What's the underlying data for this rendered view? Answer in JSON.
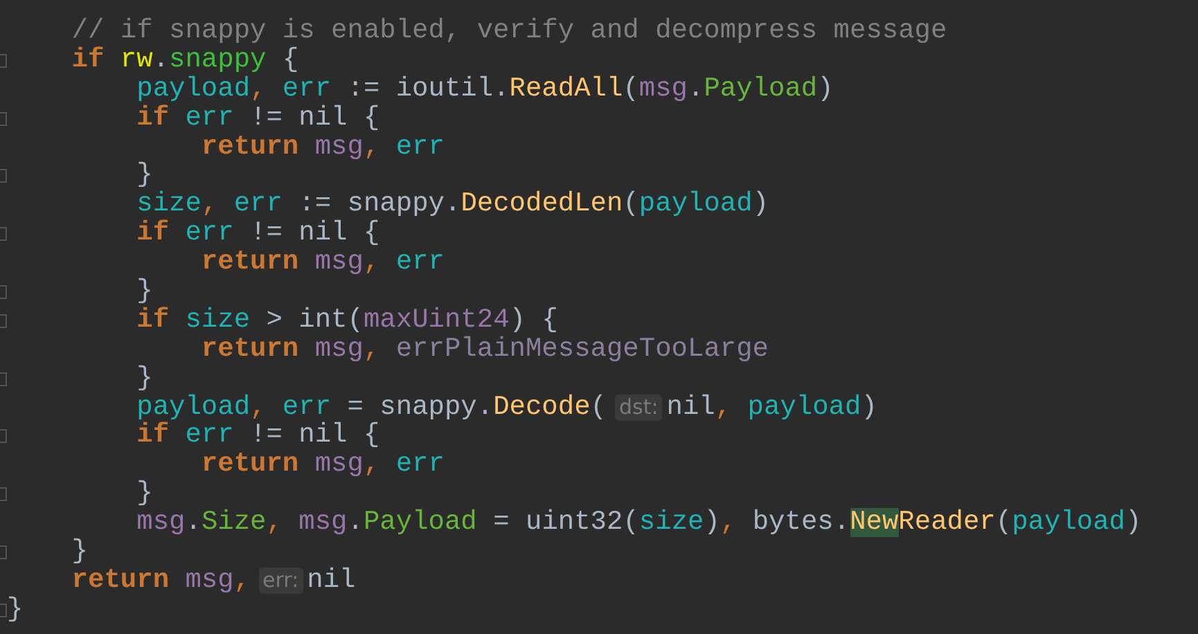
{
  "editor": {
    "lines": [
      {
        "fold": false,
        "tokens": [
          {
            "kind": "comment",
            "text": "    // if snappy is enabled, verify and decompress message"
          }
        ]
      },
      {
        "fold": true,
        "tokens": [
          {
            "kind": "keyword",
            "text": "    if"
          },
          {
            "kind": "receiver",
            "text": " rw"
          },
          {
            "kind": "plain",
            "text": "."
          },
          {
            "kind": "member",
            "text": "snappy"
          },
          {
            "kind": "plain",
            "text": " {"
          }
        ]
      },
      {
        "fold": false,
        "tokens": [
          {
            "kind": "variable",
            "text": "        payload"
          },
          {
            "kind": "punct",
            "text": ","
          },
          {
            "kind": "variable",
            "text": " err"
          },
          {
            "kind": "plain",
            "text": " := ioutil."
          },
          {
            "kind": "function",
            "text": "ReadAll"
          },
          {
            "kind": "plain",
            "text": "("
          },
          {
            "kind": "object",
            "text": "msg"
          },
          {
            "kind": "plain",
            "text": "."
          },
          {
            "kind": "field",
            "text": "Payload"
          },
          {
            "kind": "plain",
            "text": ")"
          }
        ]
      },
      {
        "fold": true,
        "tokens": [
          {
            "kind": "keyword",
            "text": "        if"
          },
          {
            "kind": "variable",
            "text": " err"
          },
          {
            "kind": "plain",
            "text": " != nil {"
          }
        ]
      },
      {
        "fold": false,
        "tokens": [
          {
            "kind": "keyword",
            "text": "            return"
          },
          {
            "kind": "object",
            "text": " msg"
          },
          {
            "kind": "punct",
            "text": ","
          },
          {
            "kind": "variable",
            "text": " err"
          }
        ]
      },
      {
        "fold": true,
        "tokens": [
          {
            "kind": "plain",
            "text": "        }"
          }
        ]
      },
      {
        "fold": false,
        "tokens": [
          {
            "kind": "variable",
            "text": "        size"
          },
          {
            "kind": "punct",
            "text": ","
          },
          {
            "kind": "variable",
            "text": " err"
          },
          {
            "kind": "plain",
            "text": " := snappy."
          },
          {
            "kind": "function",
            "text": "DecodedLen"
          },
          {
            "kind": "plain",
            "text": "("
          },
          {
            "kind": "variable",
            "text": "payload"
          },
          {
            "kind": "plain",
            "text": ")"
          }
        ]
      },
      {
        "fold": true,
        "tokens": [
          {
            "kind": "keyword",
            "text": "        if"
          },
          {
            "kind": "variable",
            "text": " err"
          },
          {
            "kind": "plain",
            "text": " != nil {"
          }
        ]
      },
      {
        "fold": false,
        "tokens": [
          {
            "kind": "keyword",
            "text": "            return"
          },
          {
            "kind": "object",
            "text": " msg"
          },
          {
            "kind": "punct",
            "text": ","
          },
          {
            "kind": "variable",
            "text": " err"
          }
        ]
      },
      {
        "fold": true,
        "tokens": [
          {
            "kind": "plain",
            "text": "        }"
          }
        ]
      },
      {
        "fold": true,
        "tokens": [
          {
            "kind": "keyword",
            "text": "        if"
          },
          {
            "kind": "variable",
            "text": " size"
          },
          {
            "kind": "plain",
            "text": " > int("
          },
          {
            "kind": "object",
            "text": "maxUint24"
          },
          {
            "kind": "plain",
            "text": ") {"
          }
        ]
      },
      {
        "fold": false,
        "tokens": [
          {
            "kind": "keyword",
            "text": "            return"
          },
          {
            "kind": "object",
            "text": " msg"
          },
          {
            "kind": "punct",
            "text": ","
          },
          {
            "kind": "constant",
            "text": " errPlainMessageTooLarge"
          }
        ]
      },
      {
        "fold": true,
        "tokens": [
          {
            "kind": "plain",
            "text": "        }"
          }
        ]
      },
      {
        "fold": false,
        "tokens": [
          {
            "kind": "variable",
            "text": "        payload"
          },
          {
            "kind": "punct",
            "text": ","
          },
          {
            "kind": "variable",
            "text": " err"
          },
          {
            "kind": "plain",
            "text": " = snappy."
          },
          {
            "kind": "function",
            "text": "Decode"
          },
          {
            "kind": "plain",
            "text": "("
          },
          {
            "kind": "hint",
            "text": "dst:"
          },
          {
            "kind": "plain",
            "text": "nil"
          },
          {
            "kind": "punct",
            "text": ","
          },
          {
            "kind": "variable",
            "text": " payload"
          },
          {
            "kind": "plain",
            "text": ")"
          }
        ]
      },
      {
        "fold": true,
        "tokens": [
          {
            "kind": "keyword",
            "text": "        if"
          },
          {
            "kind": "variable",
            "text": " err"
          },
          {
            "kind": "plain",
            "text": " != nil {"
          }
        ]
      },
      {
        "fold": false,
        "tokens": [
          {
            "kind": "keyword",
            "text": "            return"
          },
          {
            "kind": "object",
            "text": " msg"
          },
          {
            "kind": "punct",
            "text": ","
          },
          {
            "kind": "variable",
            "text": " err"
          }
        ]
      },
      {
        "fold": true,
        "tokens": [
          {
            "kind": "plain",
            "text": "        }"
          }
        ]
      },
      {
        "fold": false,
        "tokens": [
          {
            "kind": "object",
            "text": "        msg"
          },
          {
            "kind": "plain",
            "text": "."
          },
          {
            "kind": "field",
            "text": "Size"
          },
          {
            "kind": "punct",
            "text": ","
          },
          {
            "kind": "object",
            "text": " msg"
          },
          {
            "kind": "plain",
            "text": "."
          },
          {
            "kind": "field",
            "text": "Payload"
          },
          {
            "kind": "plain",
            "text": " = uint32("
          },
          {
            "kind": "variable",
            "text": "size"
          },
          {
            "kind": "plain",
            "text": ")"
          },
          {
            "kind": "punct",
            "text": ","
          },
          {
            "kind": "plain",
            "text": " bytes."
          },
          {
            "kind": "match",
            "text": "New"
          },
          {
            "kind": "function",
            "text": "Reader"
          },
          {
            "kind": "plain",
            "text": "("
          },
          {
            "kind": "variable",
            "text": "payload"
          },
          {
            "kind": "plain",
            "text": ")"
          }
        ]
      },
      {
        "fold": true,
        "tokens": [
          {
            "kind": "plain",
            "text": "    }"
          }
        ]
      },
      {
        "fold": false,
        "tokens": [
          {
            "kind": "keyword",
            "text": "    return"
          },
          {
            "kind": "object",
            "text": " msg"
          },
          {
            "kind": "punct",
            "text": ","
          },
          {
            "kind": "hint",
            "text": "err:"
          },
          {
            "kind": "plain",
            "text": "nil"
          }
        ]
      },
      {
        "fold": true,
        "tokens": [
          {
            "kind": "plain",
            "text": "}"
          }
        ]
      }
    ]
  }
}
